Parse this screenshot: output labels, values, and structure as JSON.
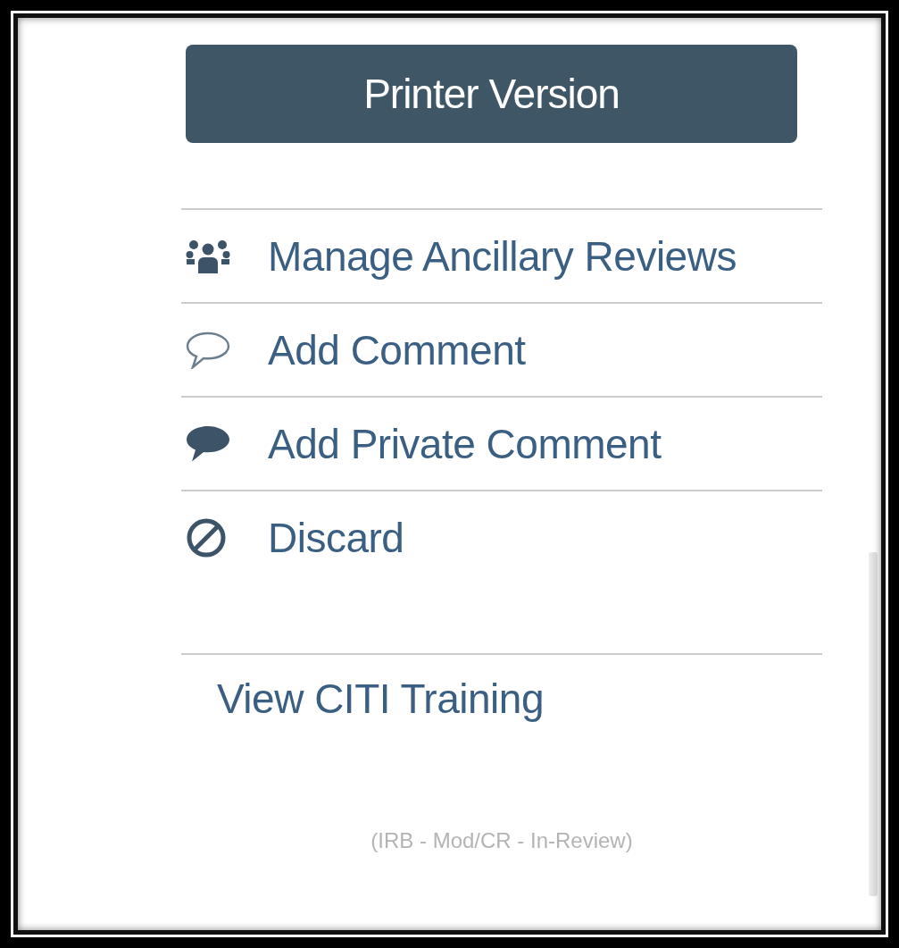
{
  "printer_button": {
    "label": "Printer Version"
  },
  "actions": [
    {
      "kind": "people",
      "label": "Manage Ancillary Reviews"
    },
    {
      "kind": "comment",
      "label": "Add Comment"
    },
    {
      "kind": "private",
      "label": "Add Private Comment"
    },
    {
      "kind": "discard",
      "label": "Discard"
    }
  ],
  "citi_link": {
    "label": "View CITI Training"
  },
  "footer": {
    "status": "(IRB - Mod/CR - In-Review)"
  }
}
